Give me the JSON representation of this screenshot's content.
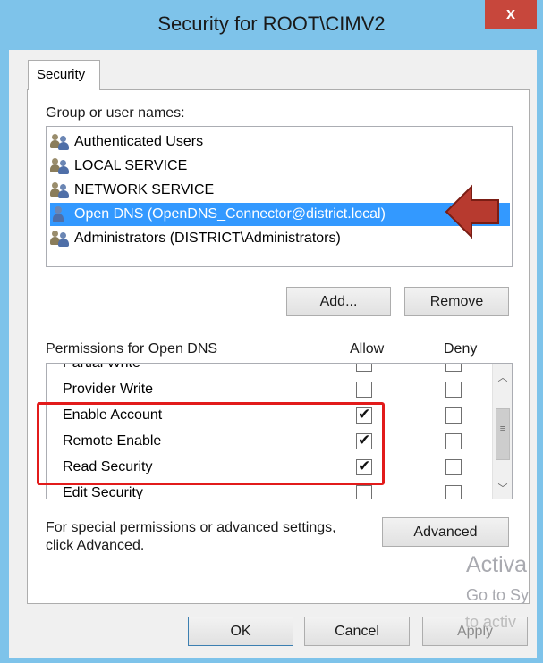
{
  "window": {
    "title": "Security for ROOT\\CIMV2",
    "close_glyph": "x"
  },
  "tabs": [
    {
      "label": "Security",
      "active": true
    }
  ],
  "groups": {
    "label": "Group or user names:",
    "items": [
      {
        "label": "Authenticated Users",
        "icon": "group-users-icon",
        "selected": false
      },
      {
        "label": "LOCAL SERVICE",
        "icon": "group-users-icon",
        "selected": false
      },
      {
        "label": "NETWORK SERVICE",
        "icon": "group-users-icon",
        "selected": false
      },
      {
        "label": "Open DNS (OpenDNS_Connector@district.local)",
        "icon": "single-user-icon",
        "selected": true
      },
      {
        "label": "Administrators (DISTRICT\\Administrators)",
        "icon": "group-users-icon",
        "selected": false
      }
    ]
  },
  "buttons": {
    "add": "Add...",
    "remove": "Remove",
    "advanced": "Advanced",
    "ok": "OK",
    "cancel": "Cancel",
    "apply": "Apply"
  },
  "permissions": {
    "label": "Permissions for Open DNS",
    "allow_header": "Allow",
    "deny_header": "Deny",
    "rows": [
      {
        "name": "Partial Write",
        "allow": false,
        "deny": false
      },
      {
        "name": "Provider Write",
        "allow": false,
        "deny": false
      },
      {
        "name": "Enable Account",
        "allow": true,
        "deny": false
      },
      {
        "name": "Remote Enable",
        "allow": true,
        "deny": false
      },
      {
        "name": "Read Security",
        "allow": true,
        "deny": false
      },
      {
        "name": "Edit Security",
        "allow": false,
        "deny": false
      }
    ]
  },
  "special_note": {
    "line1": "For special permissions or advanced settings,",
    "line2": "click Advanced."
  },
  "watermark": {
    "line1": "Activa",
    "line2": "Go to Sy",
    "line3": "to activ"
  },
  "colors": {
    "title_bar": "#7ec3ea",
    "selection": "#3399ff",
    "highlight_box": "#e21b1b",
    "arrow": "#b73a2f"
  }
}
